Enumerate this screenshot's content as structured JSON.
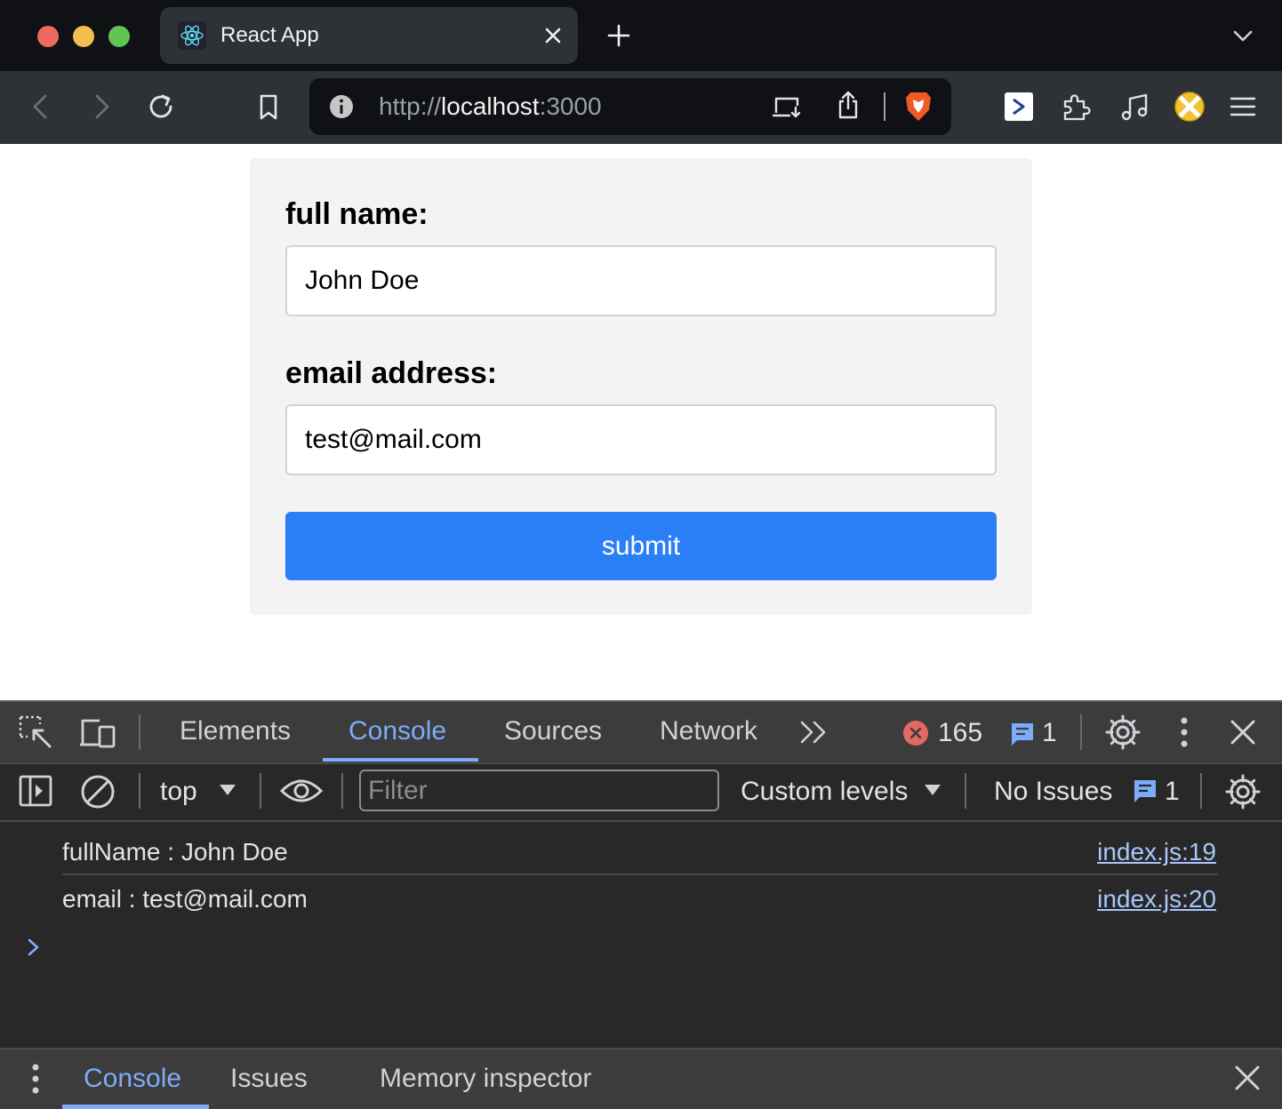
{
  "browser": {
    "tab": {
      "title": "React App",
      "icon": "react-logo-icon"
    },
    "url": {
      "scheme": "http://",
      "host": "localhost",
      "port": ":3000"
    }
  },
  "form": {
    "full_name_label": "full name:",
    "full_name_value": "John Doe",
    "email_label": "email address:",
    "email_value": "test@mail.com",
    "submit_label": "submit",
    "accent_color": "#2b7ff6"
  },
  "devtools": {
    "tabs": [
      "Elements",
      "Console",
      "Sources",
      "Network"
    ],
    "active_tab": "Console",
    "error_count": "165",
    "message_count": "1",
    "filterbar": {
      "context": "top",
      "filter_placeholder": "Filter",
      "levels": "Custom levels",
      "issues_label": "No Issues",
      "issues_count": "1"
    },
    "console_logs": [
      {
        "message": "fullName : John Doe",
        "source": "index.js:19"
      },
      {
        "message": "email : test@mail.com",
        "source": "index.js:20"
      }
    ],
    "drawer_tabs": [
      "Console",
      "Issues",
      "Memory inspector"
    ],
    "accent_color": "#7cacf8"
  }
}
